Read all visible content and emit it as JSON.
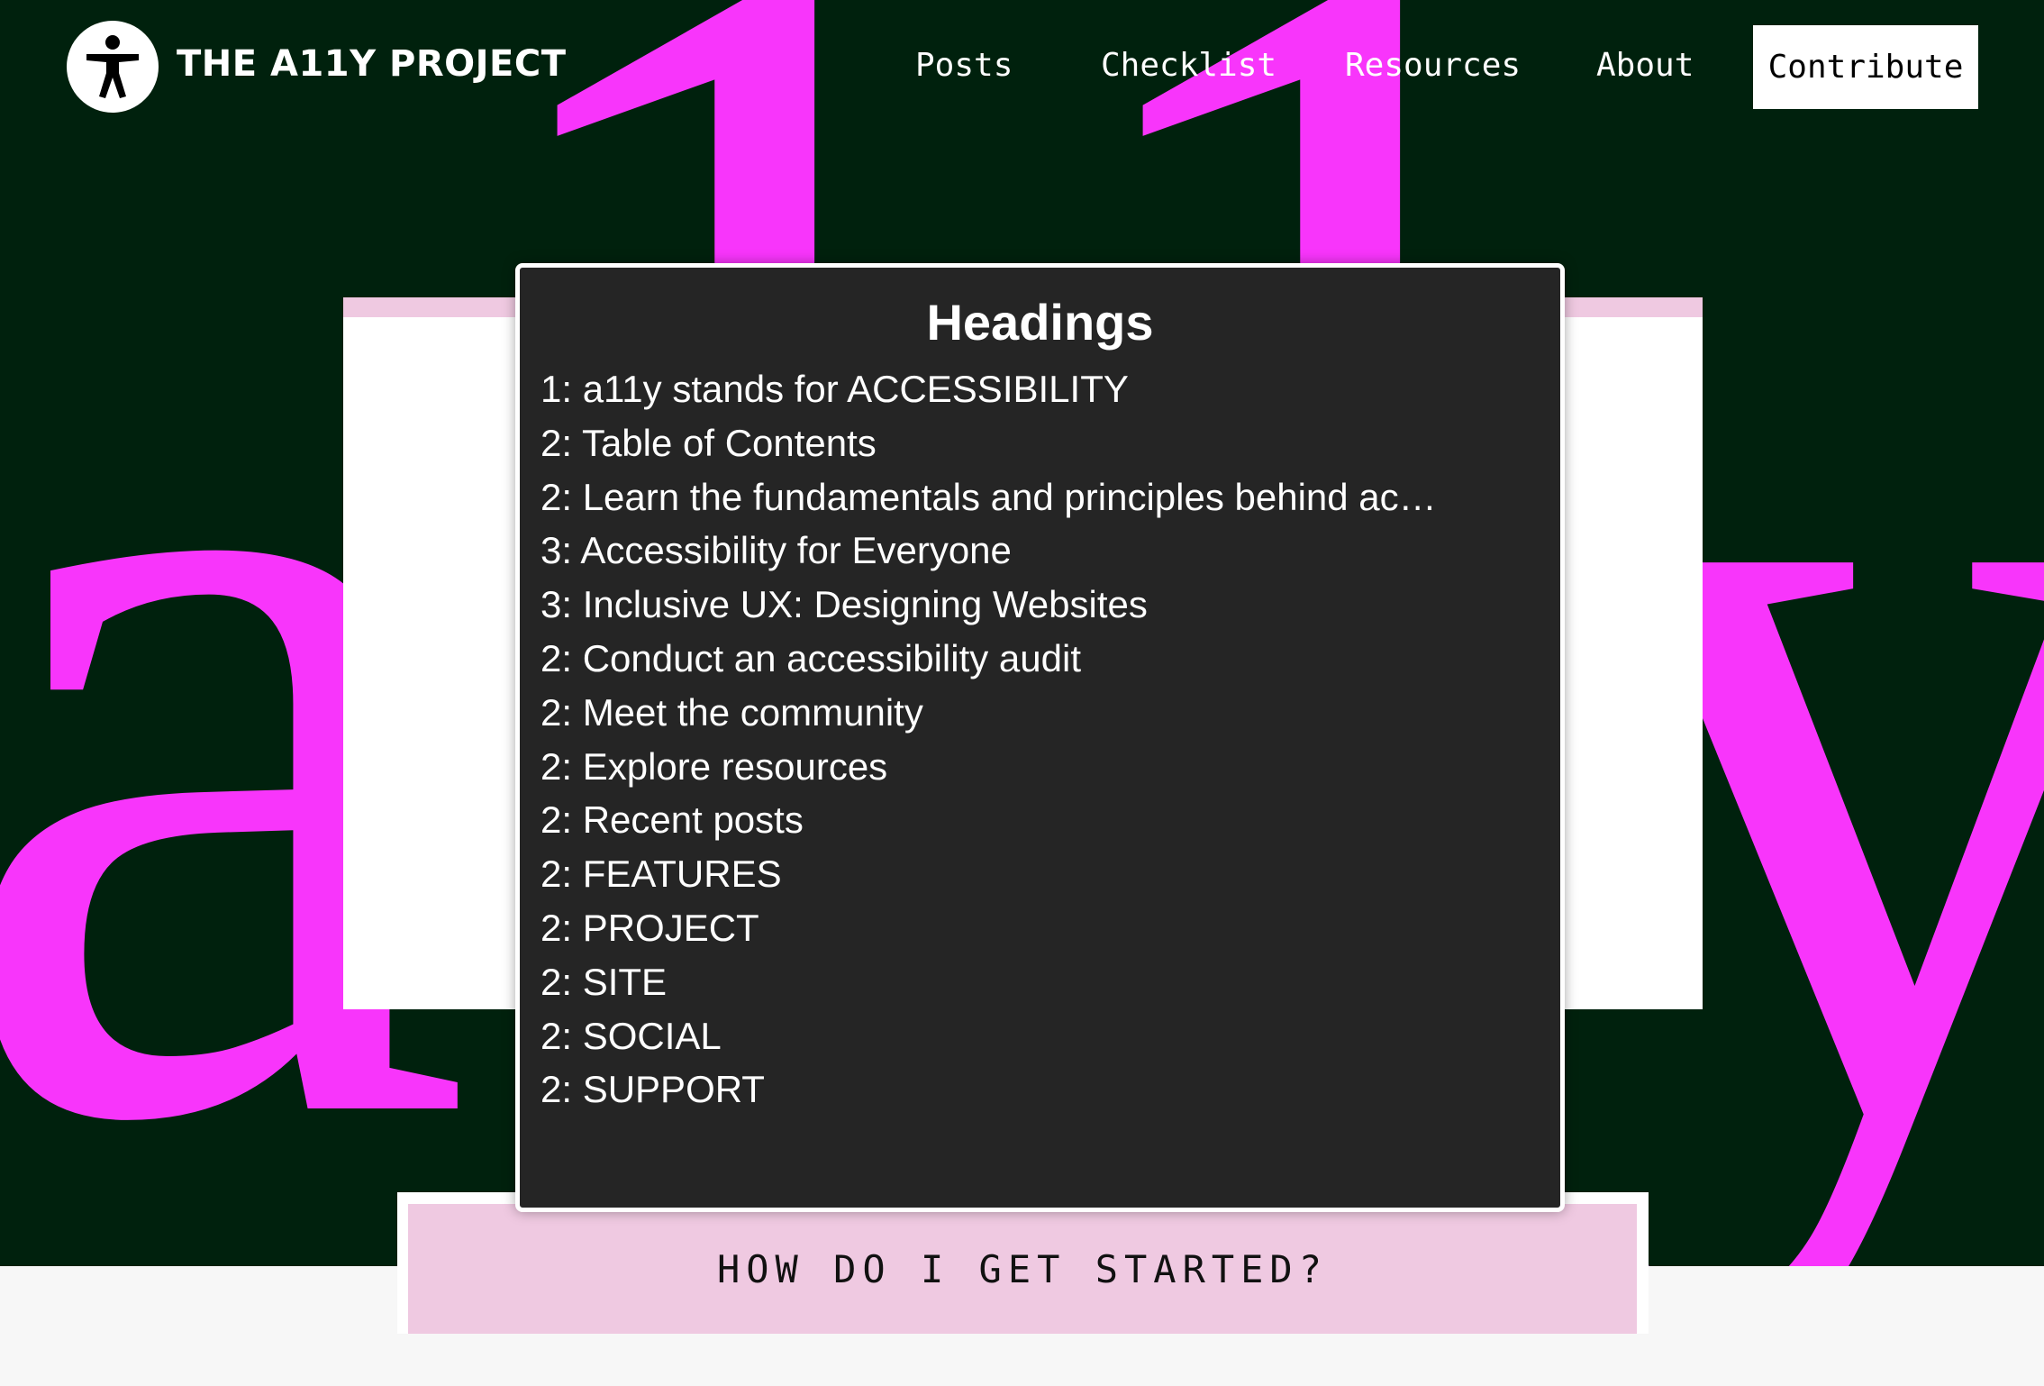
{
  "header": {
    "logo_text": "THE A11Y PROJECT",
    "logo_icon": "accessibility-person-icon",
    "nav": {
      "posts": "Posts",
      "checklist": "Checklist",
      "resources": "Resources",
      "about": "About"
    },
    "contribute_label": "Contribute"
  },
  "hero": {
    "big_letters": [
      "a",
      "1",
      "1",
      "y"
    ],
    "accent_color": "#f835fb",
    "background_color": "#00210d"
  },
  "headings_panel": {
    "title": "Headings",
    "items": [
      "1: a11y stands for ACCESSIBILITY",
      "2: Table of Contents",
      "2: Learn the fundamentals and principles behind ac…",
      "3: Accessibility for Everyone",
      "3: Inclusive UX: Designing Websites",
      "2: Conduct an accessibility audit",
      "2: Meet the community",
      "2: Explore resources",
      "2: Recent posts",
      "2: FEATURES",
      "2: PROJECT",
      "2: SITE",
      "2: SOCIAL",
      "2: SUPPORT"
    ]
  },
  "cta": {
    "label": "HOW DO I GET STARTED?",
    "color": "#efc9e1"
  }
}
